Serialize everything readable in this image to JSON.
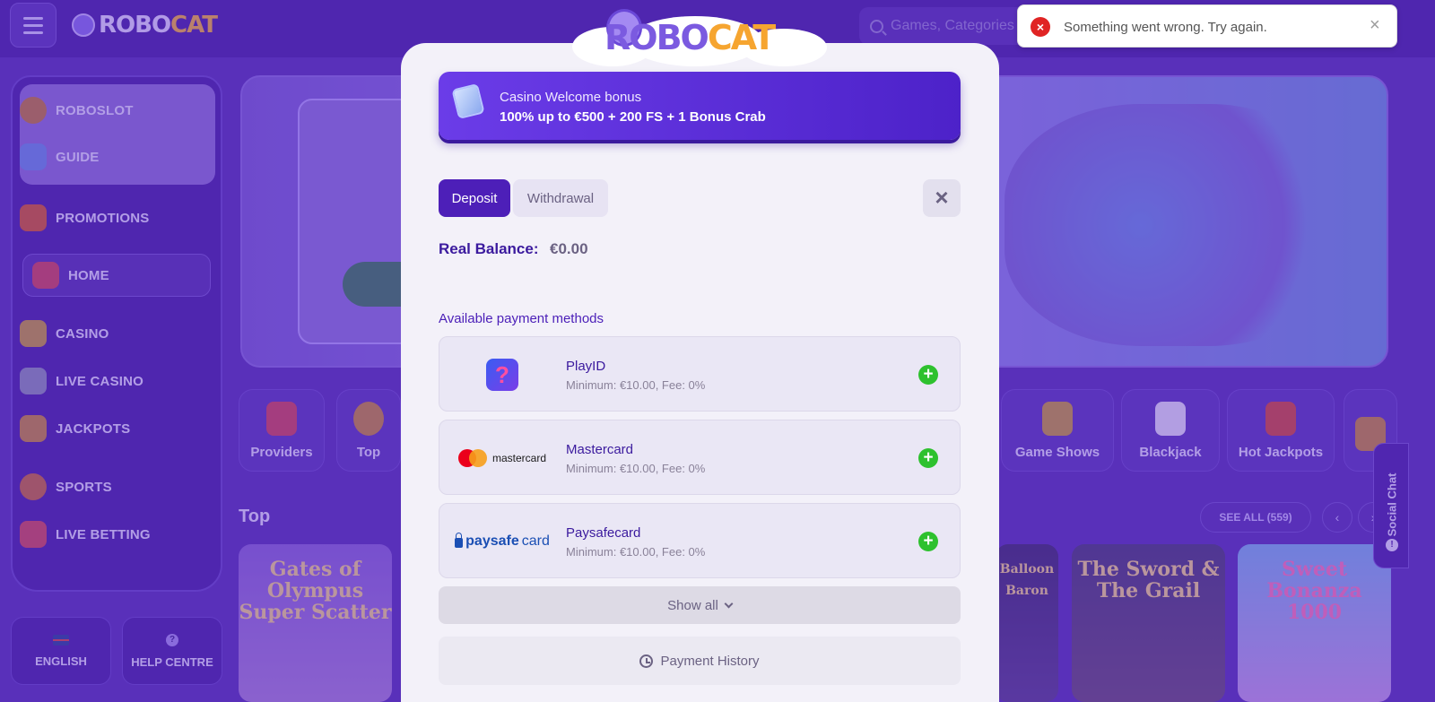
{
  "header": {
    "brand": {
      "main": "ROBO",
      "accent": "CAT"
    },
    "search_placeholder": "Games, Categories"
  },
  "sidebar": {
    "items": [
      {
        "label": "ROBOSLOT",
        "icon": "roboslot-icon"
      },
      {
        "label": "GUIDE",
        "icon": "guide-icon"
      },
      {
        "label": "PROMOTIONS",
        "icon": "gift-icon"
      },
      {
        "label": "HOME",
        "icon": "home-icon"
      },
      {
        "label": "CASINO",
        "icon": "slot-machine-icon"
      },
      {
        "label": "LIVE CASINO",
        "icon": "cards-icon"
      },
      {
        "label": "JACKPOTS",
        "icon": "jackpot-icon"
      },
      {
        "label": "SPORTS",
        "icon": "ball-icon"
      },
      {
        "label": "LIVE BETTING",
        "icon": "live-icon"
      }
    ],
    "language": "ENGLISH",
    "help": "HELP CENTRE"
  },
  "categories": [
    "Providers",
    "Top",
    "Game Shows",
    "Blackjack",
    "Hot Jackpots"
  ],
  "section": {
    "title": "Top",
    "see_all": "SEE ALL (559)",
    "prev": "‹",
    "next": "›"
  },
  "games": [
    {
      "title": "Gates of Olympus Super Scatter"
    },
    {
      "title": "Balloon Baron"
    },
    {
      "title": "The Sword & The Grail"
    },
    {
      "title": "Sweet Bonanza 1000"
    }
  ],
  "social_chat": "Social Chat",
  "modal": {
    "logo": {
      "main": "ROBO",
      "accent": "CAT"
    },
    "bonus": {
      "line1": "Casino Welcome bonus",
      "line2": "100% up to €500 + 200 FS + 1 Bonus Crab"
    },
    "tabs": {
      "deposit": "Deposit",
      "withdrawal": "Withdrawal"
    },
    "close_symbol": "×",
    "balance": {
      "label": "Real Balance:",
      "value": "€0.00"
    },
    "methods_label": "Available payment methods",
    "methods": [
      {
        "name": "PlayID",
        "info": "Minimum: €10.00, Fee: 0%",
        "logo_text": "?"
      },
      {
        "name": "Mastercard",
        "info": "Minimum: €10.00, Fee: 0%",
        "logo_text": "mastercard"
      },
      {
        "name": "Paysafecard",
        "info": "Minimum: €10.00, Fee: 0%",
        "logo_text": {
          "bold": "paysafe",
          "rest": "card"
        }
      }
    ],
    "add_symbol": "+",
    "show_all": "Show all",
    "payment_history": "Payment History"
  },
  "toast": {
    "message": "Something went wrong. Try again.",
    "icon_symbol": "×",
    "close_symbol": "×",
    "type": "error"
  },
  "colors": {
    "brand_purple": "#4d1fb8",
    "accent_green": "#2ec12e",
    "error_red": "#e02424"
  }
}
